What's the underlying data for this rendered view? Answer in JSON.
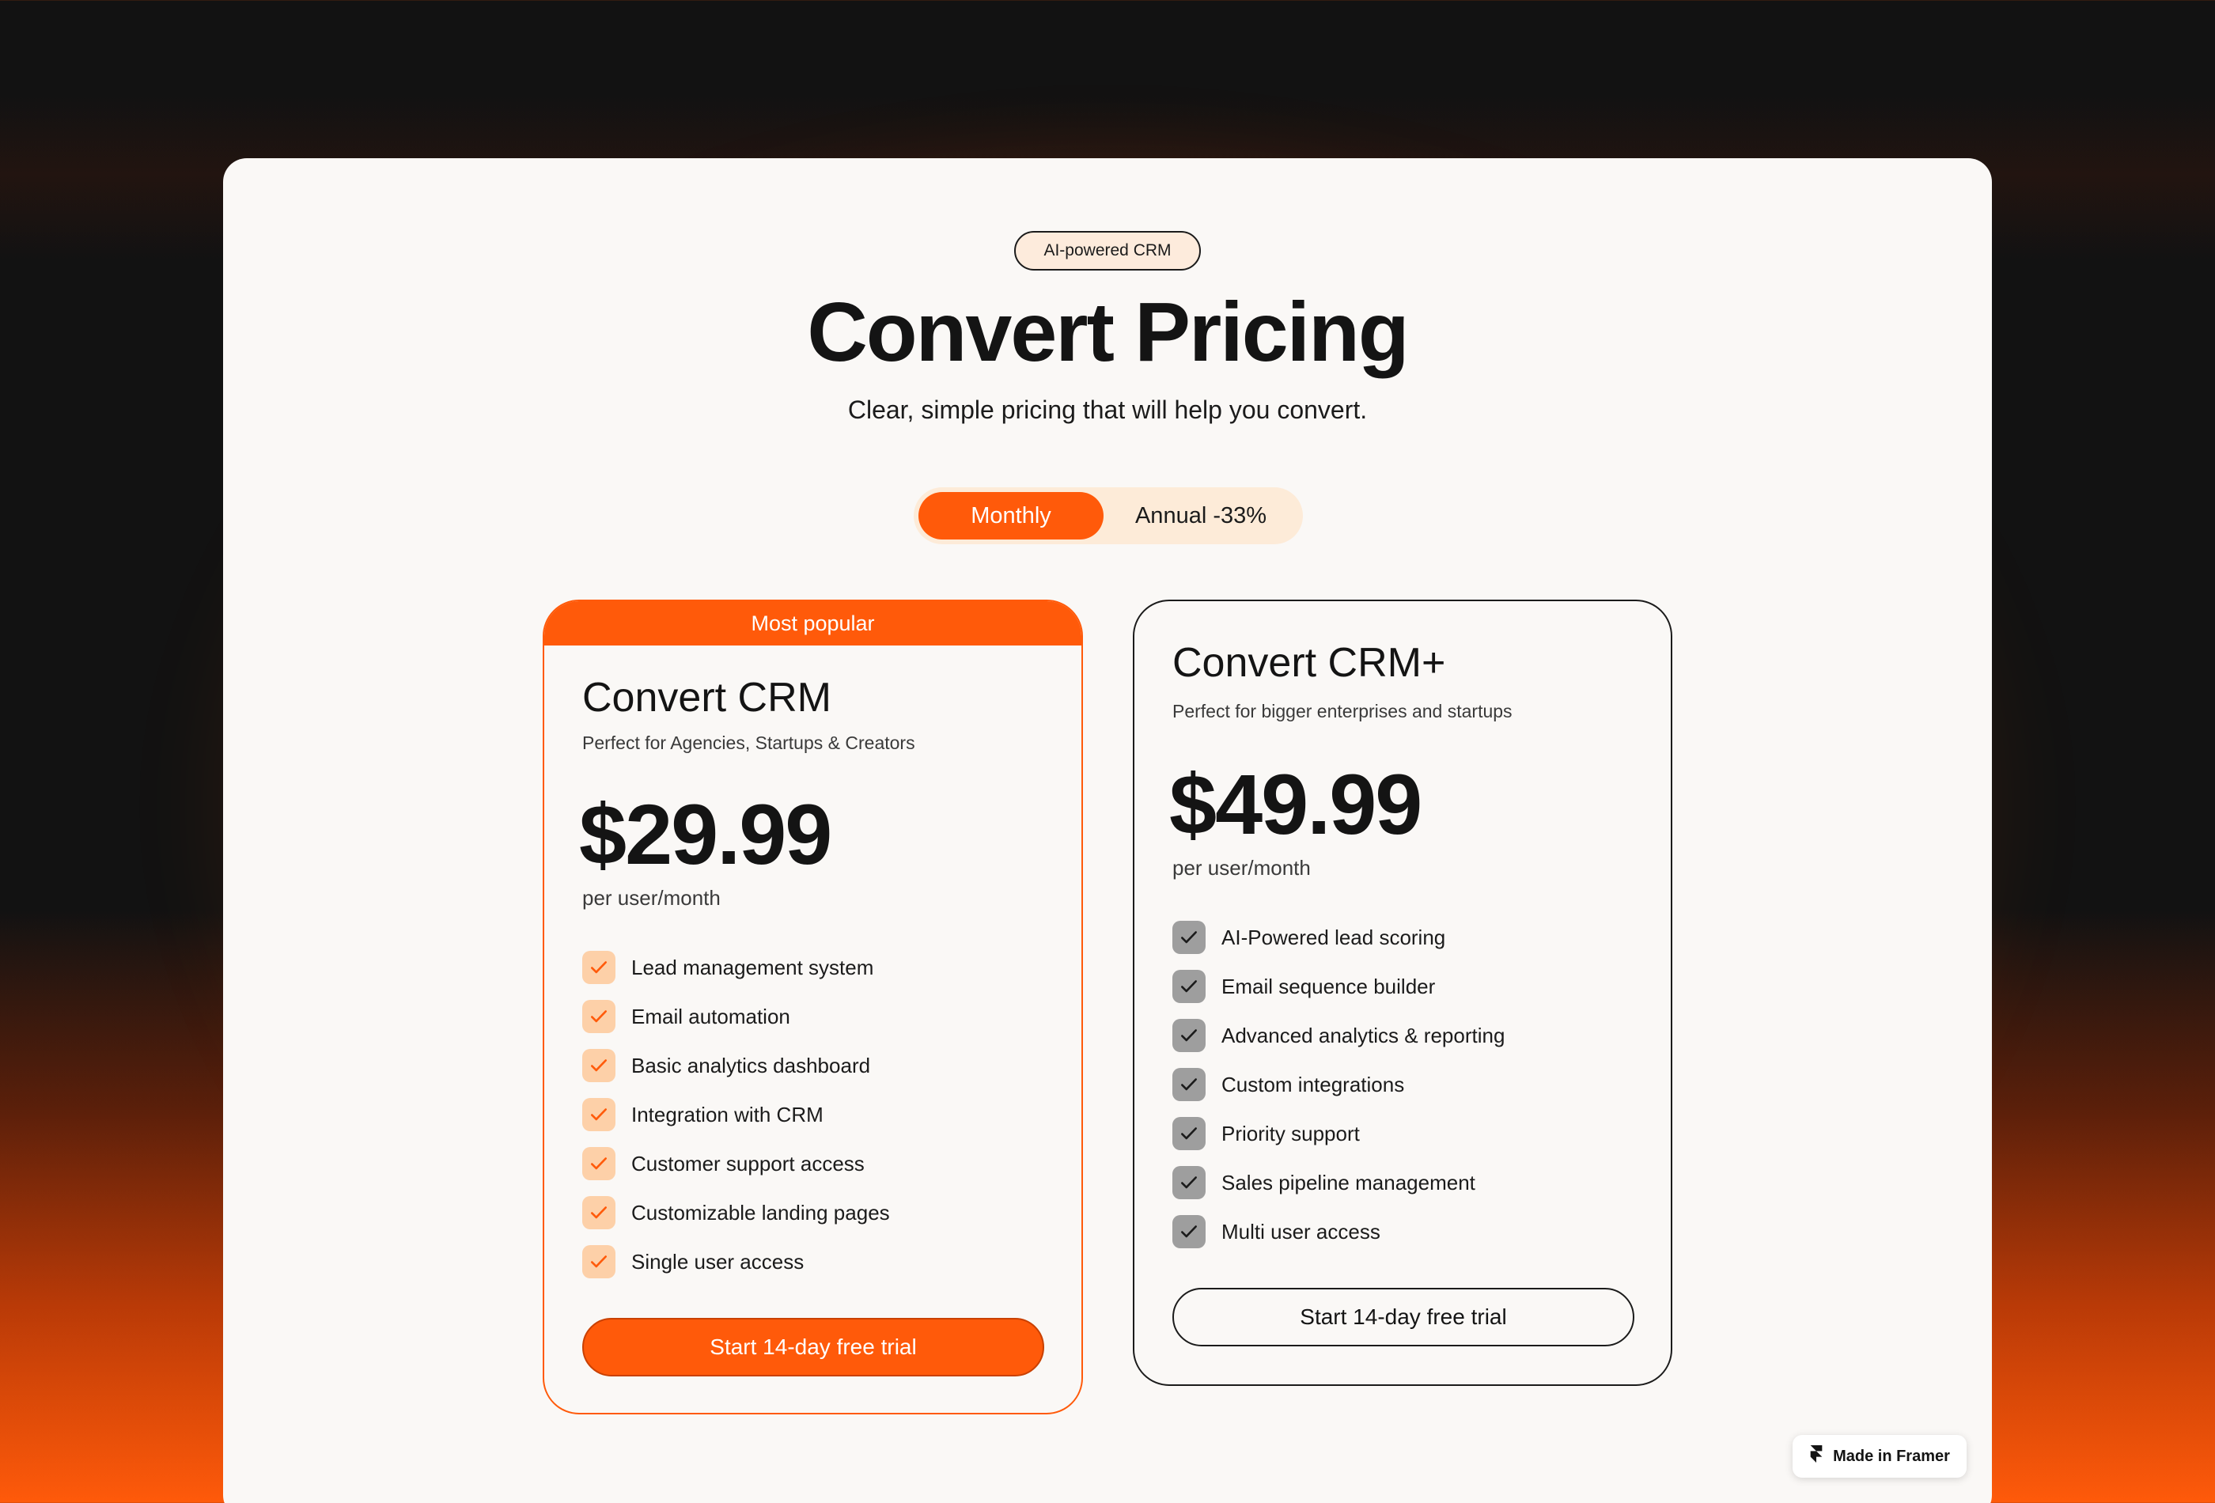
{
  "badge": "AI-powered CRM",
  "title": "Convert Pricing",
  "subtitle": "Clear, simple pricing that will help you convert.",
  "billing_toggle": {
    "monthly": "Monthly",
    "annual": "Annual -33%",
    "selected": "Monthly"
  },
  "plans": [
    {
      "ribbon": "Most popular",
      "name": "Convert CRM",
      "description": "Perfect for Agencies, Startups & Creators",
      "price": "$29.99",
      "per": "per user/month",
      "features": [
        "Lead management system",
        "Email automation",
        "Basic analytics dashboard",
        "Integration with CRM",
        "Customer support access",
        "Customizable landing pages",
        "Single user access"
      ],
      "cta": "Start 14-day free trial"
    },
    {
      "name": "Convert CRM+",
      "description": "Perfect for bigger enterprises and startups",
      "price": "$49.99",
      "per": "per user/month",
      "features": [
        "AI-Powered lead scoring",
        "Email sequence builder",
        "Advanced analytics & reporting",
        "Custom integrations",
        "Priority support",
        "Sales pipeline management",
        "Multi user access"
      ],
      "cta": "Start 14-day free trial"
    }
  ],
  "framer_badge": "Made in Framer",
  "colors": {
    "accent": "#ff5a0a",
    "background_dark": "#121212",
    "panel": "#faf8f6",
    "check_light": "#fdd0a8",
    "check_grey": "#9e9e9e"
  },
  "icons": {
    "check": "check-icon",
    "framer": "framer-logo-icon"
  }
}
